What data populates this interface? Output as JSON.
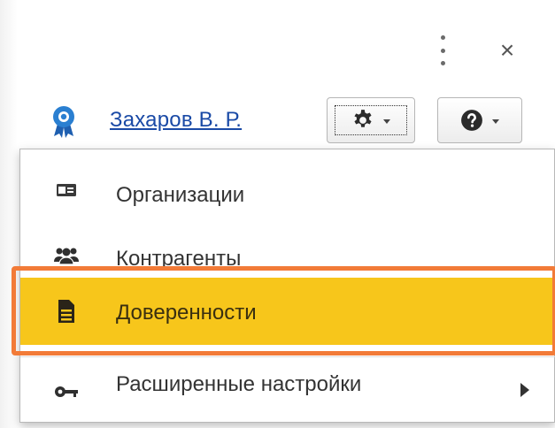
{
  "window": {
    "menu_icon": "more-vertical-icon",
    "close_glyph": "×"
  },
  "header": {
    "user_icon": "award-badge-icon",
    "user_name": "Захаров В. Р.",
    "settings_button_icon": "gear-icon",
    "help_button_icon": "question-circle-icon"
  },
  "menu": {
    "items": [
      {
        "label": "Организации",
        "icon": "id-card-icon"
      },
      {
        "label": "Контрагенты",
        "icon": "users-icon"
      },
      {
        "label": "Доверенности",
        "icon": "document-icon",
        "highlighted": true
      },
      {
        "label": "Расширенные настройки",
        "icon": "key-icon",
        "has_submenu": true
      }
    ]
  },
  "colors": {
    "link": "#1a4aa6",
    "highlight_bg": "#f7c61b",
    "annotation_frame": "#f27b38",
    "badge_blue": "#2a7fd1"
  }
}
